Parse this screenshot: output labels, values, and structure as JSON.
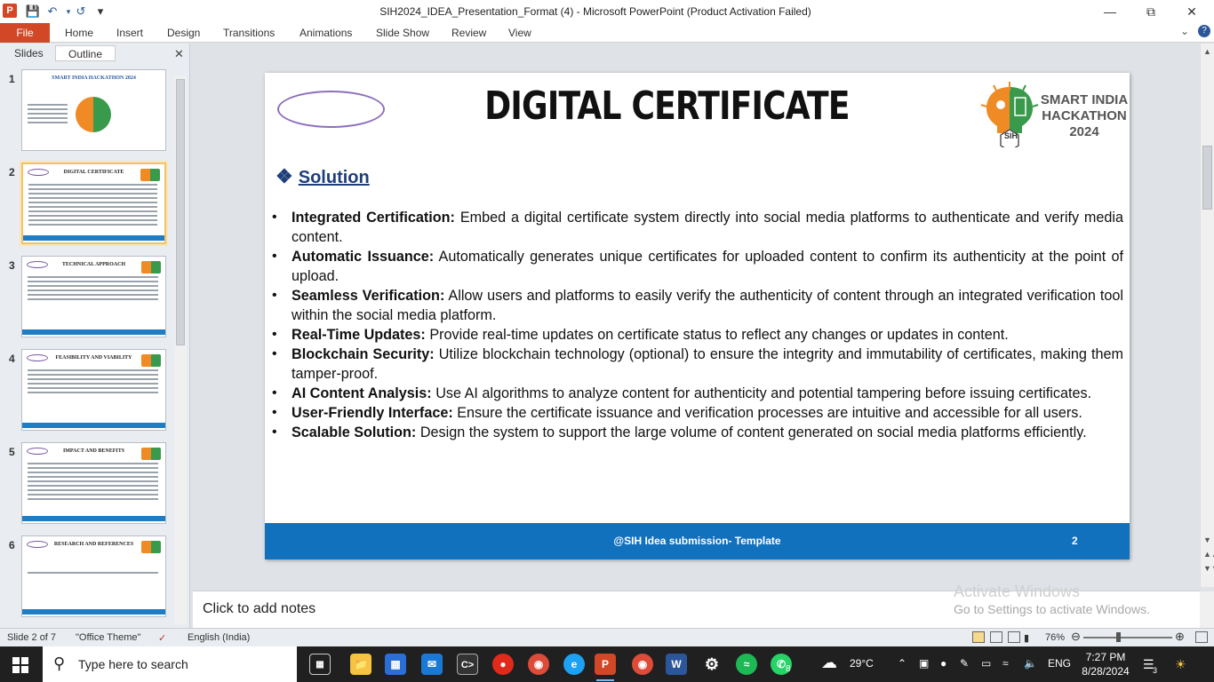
{
  "window": {
    "title": "SIH2024_IDEA_Presentation_Format (4)  -  Microsoft PowerPoint (Product Activation Failed)",
    "app_icon": "P"
  },
  "ribbon": {
    "file_label": "File",
    "tabs": [
      "Home",
      "Insert",
      "Design",
      "Transitions",
      "Animations",
      "Slide Show",
      "Review",
      "View"
    ]
  },
  "left_panel": {
    "tabs": [
      "Slides",
      "Outline"
    ],
    "thumbnails": [
      {
        "num": "1",
        "title": "SMART INDIA HACKATHON 2024"
      },
      {
        "num": "2",
        "title": "DIGITAL CERTIFICATE"
      },
      {
        "num": "3",
        "title": "TECHNICAL   APPROACH"
      },
      {
        "num": "4",
        "title": "FEASIBILITY AND VIABILITY"
      },
      {
        "num": "5",
        "title": "IMPACT AND BENEFITS"
      },
      {
        "num": "6",
        "title": "RESEARCH    AND REFERENCES"
      }
    ]
  },
  "slide": {
    "title": "DIGITAL CERTIFICATE",
    "logo_text": [
      "SMART INDIA",
      "HACKATHON",
      "2024"
    ],
    "logo_badge": "SIH",
    "section_heading": "Solution",
    "bullets": [
      {
        "bold": "Integrated Certification:",
        "text": " Embed a digital certificate system directly into social media platforms to authenticate and verify media content."
      },
      {
        "bold": "Automatic Issuance:",
        "text": " Automatically generates unique certificates for uploaded content to confirm its authenticity at the point of upload."
      },
      {
        "bold": "Seamless Verification:",
        "text": " Allow users and platforms to easily verify the authenticity of content through an integrated verification tool within the social media platform."
      },
      {
        "bold": "Real-Time Updates:",
        "text": " Provide real-time updates on certificate status to reflect any changes or updates in content."
      },
      {
        "bold": "Blockchain Security:",
        "text": " Utilize blockchain technology (optional) to ensure the integrity and immutability of certificates, making them tamper-proof."
      },
      {
        "bold": "AI Content Analysis:",
        "text": " Use AI algorithms to analyze content for authenticity and potential tampering before issuing certificates."
      },
      {
        "bold": "User-Friendly Interface:",
        "text": " Ensure the certificate issuance and verification processes are intuitive and accessible for all users."
      },
      {
        "bold": "Scalable Solution:",
        "text": " Design the system to support the large volume of content generated on social media platforms efficiently."
      }
    ],
    "footer_text": "@SIH Idea submission- Template",
    "page_number": "2"
  },
  "notes": {
    "placeholder": "Click to add notes",
    "watermark_line1": "Activate Windows",
    "watermark_line2": "Go to Settings to activate Windows."
  },
  "statusbar": {
    "slide_of": "Slide 2 of 7",
    "theme": "\"Office Theme\"",
    "language": "English (India)",
    "zoom": "76%"
  },
  "taskbar": {
    "search_placeholder": "Type here to search",
    "weather": "29°C",
    "lang": "ENG",
    "time": "7:27 PM",
    "date": "8/28/2024",
    "notif_count": "3",
    "whatsapp_badge": "8"
  },
  "colors": {
    "accent": "#d24726",
    "footer_blue": "#1271bd",
    "heading_blue": "#1f3f7a"
  }
}
